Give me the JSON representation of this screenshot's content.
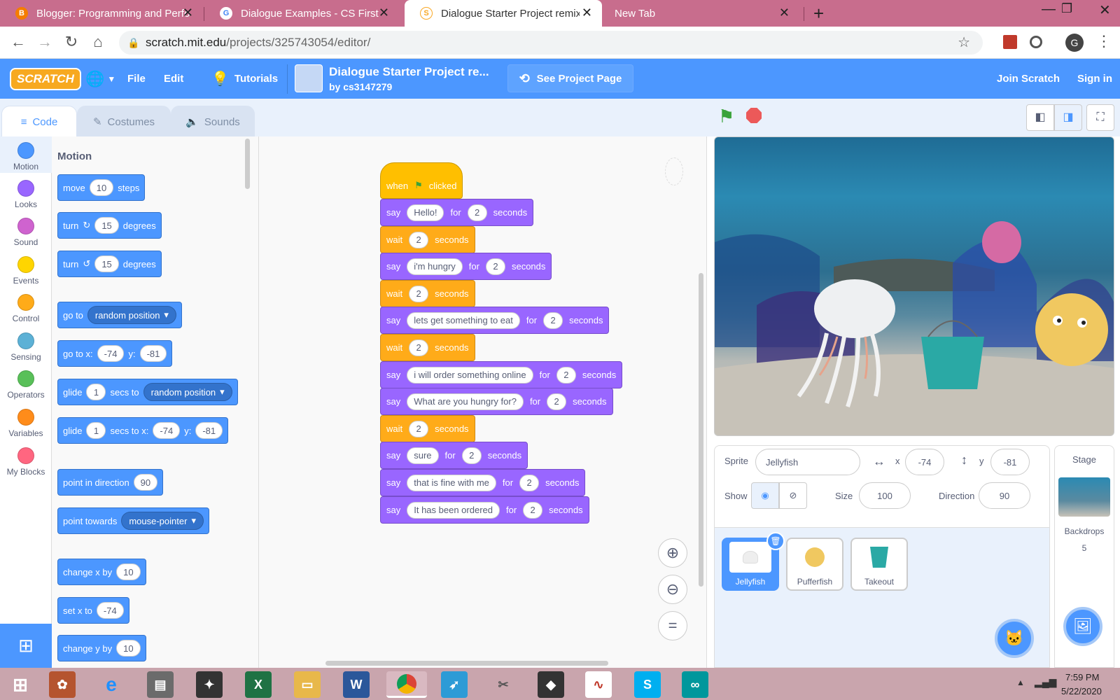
{
  "browser": {
    "tabs": [
      {
        "title": "Blogger: Programming and Perfo",
        "favicon": "blogger-icon"
      },
      {
        "title": "Dialogue Examples - CS First",
        "favicon": "google-icon"
      },
      {
        "title": "Dialogue Starter Project remix or",
        "favicon": "scratch-icon"
      },
      {
        "title": "New Tab",
        "favicon": ""
      }
    ],
    "url_domain": "scratch.mit.edu",
    "url_path": "/projects/325743054/editor/",
    "profile_initial": "G"
  },
  "menu": {
    "logo": "SCRATCH",
    "file": "File",
    "edit": "Edit",
    "tutorials": "Tutorials",
    "project_title": "Dialogue Starter Project re...",
    "author": "by cs3147279",
    "see_project": "See Project Page",
    "join": "Join Scratch",
    "sign_in": "Sign in"
  },
  "editor_tabs": {
    "code": "Code",
    "costumes": "Costumes",
    "sounds": "Sounds"
  },
  "categories": [
    {
      "label": "Motion",
      "color": "#4c97ff"
    },
    {
      "label": "Looks",
      "color": "#9966ff"
    },
    {
      "label": "Sound",
      "color": "#cf63cf"
    },
    {
      "label": "Events",
      "color": "#ffd500"
    },
    {
      "label": "Control",
      "color": "#ffab19"
    },
    {
      "label": "Sensing",
      "color": "#5cb1d6"
    },
    {
      "label": "Operators",
      "color": "#59c059"
    },
    {
      "label": "Variables",
      "color": "#ff8c1a"
    },
    {
      "label": "My Blocks",
      "color": "#ff6680"
    }
  ],
  "palette": {
    "heading": "Motion",
    "move": {
      "a": "move",
      "n": "10",
      "b": "steps"
    },
    "turn_right": {
      "a": "turn",
      "n": "15",
      "b": "degrees"
    },
    "turn_left": {
      "a": "turn",
      "n": "15",
      "b": "degrees"
    },
    "goto": {
      "a": "go to",
      "d": "random position"
    },
    "goto_xy": {
      "a": "go to x:",
      "x": "-74",
      "b": "y:",
      "y": "-81"
    },
    "glide": {
      "a": "glide",
      "n": "1",
      "b": "secs to",
      "d": "random position"
    },
    "glide_xy": {
      "a": "glide",
      "n": "1",
      "b": "secs to x:",
      "x": "-74",
      "c": "y:",
      "y": "-81"
    },
    "point_dir": {
      "a": "point in direction",
      "n": "90"
    },
    "point_towards": {
      "a": "point towards",
      "d": "mouse-pointer"
    },
    "change_x": {
      "a": "change x by",
      "n": "10"
    },
    "set_x": {
      "a": "set x to",
      "n": "-74"
    },
    "change_y": {
      "a": "change y by",
      "n": "10"
    }
  },
  "script": {
    "hat": {
      "a": "when",
      "b": "clicked"
    },
    "blocks": [
      {
        "type": "say",
        "text": "Hello!",
        "secs": "2"
      },
      {
        "type": "wait",
        "secs": "2"
      },
      {
        "type": "say",
        "text": "i'm hungry",
        "secs": "2"
      },
      {
        "type": "wait",
        "secs": "2"
      },
      {
        "type": "say",
        "text": "lets get something to eat",
        "secs": "2"
      },
      {
        "type": "wait",
        "secs": "2"
      },
      {
        "type": "say",
        "text": "i will order something online",
        "secs": "2"
      },
      {
        "type": "say",
        "text": "What are you hungry for?",
        "secs": "2"
      },
      {
        "type": "wait",
        "secs": "2"
      },
      {
        "type": "say",
        "text": "sure",
        "secs": "2"
      },
      {
        "type": "say",
        "text": "that is fine with me",
        "secs": "2"
      },
      {
        "type": "say",
        "text": "It has been ordered",
        "secs": "2"
      }
    ],
    "labels": {
      "say": "say",
      "for": "for",
      "seconds": "seconds",
      "wait": "wait"
    }
  },
  "sprite_info": {
    "sprite_label": "Sprite",
    "sprite_name": "Jellyfish",
    "x_label": "x",
    "x": "-74",
    "y_label": "y",
    "y": "-81",
    "show_label": "Show",
    "size_label": "Size",
    "size": "100",
    "direction_label": "Direction",
    "direction": "90"
  },
  "sprites": [
    {
      "name": "Jellyfish",
      "selected": true
    },
    {
      "name": "Pufferfish",
      "selected": false
    },
    {
      "name": "Takeout",
      "selected": false
    }
  ],
  "stage_pane": {
    "title": "Stage",
    "backdrops_label": "Backdrops",
    "backdrops_count": "5"
  },
  "taskbar": {
    "time": "7:59 PM",
    "date": "5/22/2020"
  }
}
